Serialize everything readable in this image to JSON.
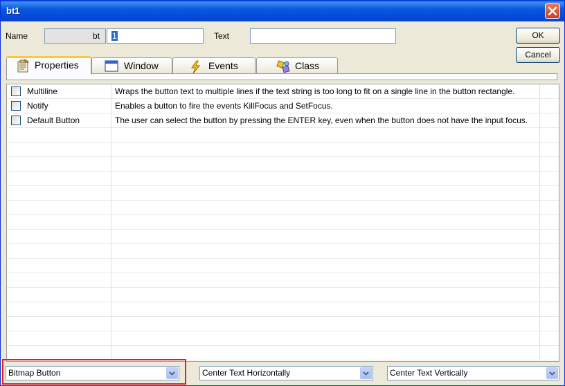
{
  "window": {
    "title": "bt1"
  },
  "header": {
    "name_label": "Name",
    "name_prefix": "bt",
    "name_value": "1",
    "text_label": "Text",
    "text_value": ""
  },
  "buttons": {
    "ok": "OK",
    "cancel": "Cancel"
  },
  "tabs": [
    {
      "label": "Properties",
      "icon": "properties-icon",
      "active": true
    },
    {
      "label": "Window",
      "icon": "window-icon",
      "active": false
    },
    {
      "label": "Events",
      "icon": "lightning-icon",
      "active": false
    },
    {
      "label": "Class",
      "icon": "class-icon",
      "active": false
    }
  ],
  "properties": [
    {
      "name": "Multiline",
      "checked": false,
      "description": "Wraps the button text to multiple lines if the text string is too long to fit on a single line in the button rectangle."
    },
    {
      "name": "Notify",
      "checked": false,
      "description": "Enables a button to fire the events KillFocus and SetFocus."
    },
    {
      "name": "Default Button",
      "checked": false,
      "description": "The user can select the button by pressing the ENTER key, even when the button does not have the input focus."
    }
  ],
  "combos": {
    "button_type": "Bitmap Button",
    "horizontal_align": "Center Text Horizontally",
    "vertical_align": "Center Text Vertically"
  },
  "colors": {
    "title_bar": "#0a58e0",
    "highlight": "#e81c24",
    "tab_active_accent": "#ffc73c"
  }
}
